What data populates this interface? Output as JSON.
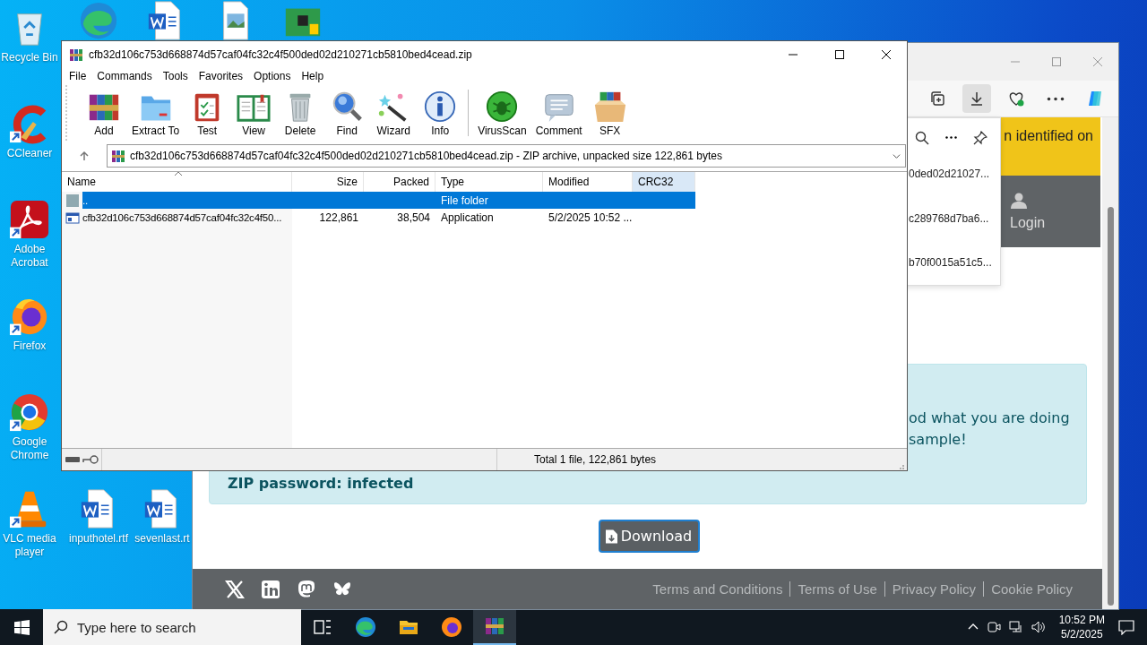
{
  "desktop_icons": [
    {
      "kind": "recycle-bin",
      "label": "Recycle Bin",
      "shortcut": false
    },
    {
      "kind": "ccleaner",
      "label": "CCleaner",
      "shortcut": true
    },
    {
      "kind": "acrobat",
      "label": "Adobe Acrobat",
      "shortcut": true
    },
    {
      "kind": "firefox",
      "label": "Firefox",
      "shortcut": true
    },
    {
      "kind": "chrome",
      "label": "Google Chrome",
      "shortcut": true
    },
    {
      "kind": "vlc",
      "label": "VLC media player",
      "shortcut": true
    },
    {
      "kind": "edge"
    },
    {
      "kind": "word"
    },
    {
      "kind": "image"
    },
    {
      "kind": "board"
    },
    {
      "kind": "word",
      "label": "inputhotel.rtf",
      "shortcut": false
    },
    {
      "kind": "word",
      "label": "sevenlast.rt",
      "shortcut": false
    }
  ],
  "browser": {
    "toolbar": [
      {
        "kind": "collections",
        "selected": false
      },
      {
        "kind": "downloads",
        "selected": true
      },
      {
        "kind": "health",
        "selected": false
      },
      {
        "kind": "more",
        "selected": false
      },
      {
        "kind": "copilot",
        "selected": false
      }
    ],
    "downloads": [
      "0ded02d21027...",
      "c289768d7ba6...",
      "b70f0015a51c5..."
    ],
    "banner": "n identified on",
    "login": "Login",
    "info_lines": [
      "od what you are doing",
      "sample!"
    ],
    "password": "ZIP password: infected",
    "download_button": "Download",
    "social": [
      {
        "kind": "x"
      },
      {
        "kind": "linkedin"
      },
      {
        "kind": "mastodon"
      },
      {
        "kind": "bluesky"
      }
    ],
    "footer_links": [
      "Terms and Conditions",
      "Terms of Use",
      "Privacy Policy",
      "Cookie Policy"
    ]
  },
  "winrar": {
    "title": "cfb32d106c753d668874d57caf04fc32c4f500ded02d210271cb5810bed4cead.zip",
    "menu": [
      "File",
      "Commands",
      "Tools",
      "Favorites",
      "Options",
      "Help"
    ],
    "toolbar_groups": [
      {
        "items": [
          {
            "kind": "books",
            "label": "Add"
          },
          {
            "kind": "folder",
            "label": "Extract To"
          },
          {
            "kind": "clipboard",
            "label": "Test"
          },
          {
            "kind": "book",
            "label": "View"
          },
          {
            "kind": "trash",
            "label": "Delete"
          },
          {
            "kind": "magnifier",
            "label": "Find"
          },
          {
            "kind": "wand",
            "label": "Wizard"
          },
          {
            "kind": "info",
            "label": "Info"
          }
        ]
      },
      {
        "items": [
          {
            "kind": "bug",
            "label": "VirusScan"
          },
          {
            "kind": "speech",
            "label": "Comment"
          },
          {
            "kind": "box",
            "label": "SFX"
          }
        ]
      }
    ],
    "address": "cfb32d106c753d668874d57caf04fc32c4f500ded02d210271cb5810bed4cead.zip - ZIP archive, unpacked size 122,861 bytes",
    "columns": [
      {
        "label": "Name",
        "sorted": true,
        "hovered": false
      },
      {
        "label": "Size",
        "sorted": false,
        "hovered": false
      },
      {
        "label": "Packed",
        "sorted": false,
        "hovered": false
      },
      {
        "label": "Type",
        "sorted": false,
        "hovered": false
      },
      {
        "label": "Modified",
        "sorted": false,
        "hovered": false
      },
      {
        "label": "CRC32",
        "sorted": false,
        "hovered": true
      }
    ],
    "rows": [
      {
        "kind": "folder",
        "name": "..",
        "size": "",
        "packed": "",
        "type": "File folder",
        "modified": "",
        "selected": true
      },
      {
        "kind": "app",
        "name": "cfb32d106c753d668874d57caf04fc32c4f50...",
        "size": "122,861",
        "packed": "38,504",
        "type": "Application",
        "modified": "5/2/2025 10:52 ...",
        "selected": false
      }
    ],
    "status": "Total 1 file, 122,861 bytes"
  },
  "taskbar": {
    "search_placeholder": "Type here to search",
    "apps": [
      {
        "kind": "task-view",
        "selected": false
      },
      {
        "kind": "edge",
        "selected": false
      },
      {
        "kind": "explorer",
        "selected": false
      },
      {
        "kind": "firefox",
        "selected": false
      },
      {
        "kind": "winrar",
        "selected": true
      }
    ],
    "time": "10:52 PM",
    "date": "5/2/2025"
  }
}
